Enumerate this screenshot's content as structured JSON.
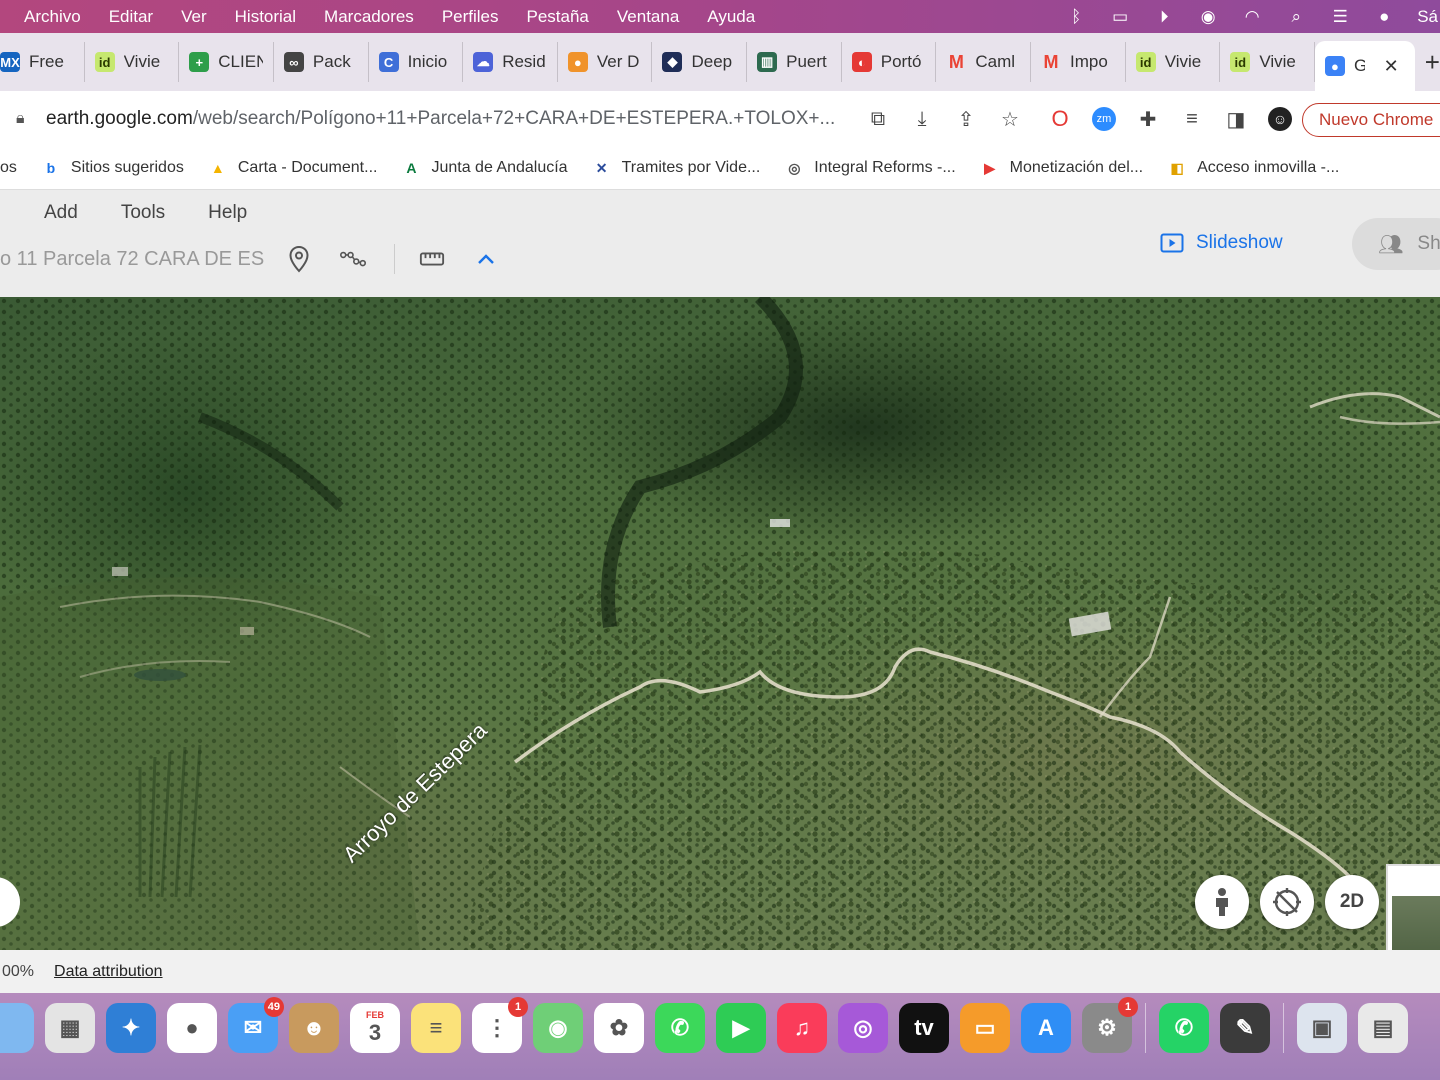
{
  "menubar": {
    "items": [
      "Archivo",
      "Editar",
      "Ver",
      "Historial",
      "Marcadores",
      "Perfiles",
      "Pestaña",
      "Ventana",
      "Ayuda"
    ],
    "right_text": "Sá"
  },
  "tabs": [
    {
      "label": "Free",
      "fav": "MX",
      "color": "#1565c0"
    },
    {
      "label": "Vivie",
      "fav": "id",
      "color": "#c6e86f"
    },
    {
      "label": "CLIEN",
      "fav": "+",
      "color": "#2e9e4a"
    },
    {
      "label": "Pack",
      "fav": "∞",
      "color": "#444444"
    },
    {
      "label": "Inicio",
      "fav": "C",
      "color": "#3f6fd8"
    },
    {
      "label": "Resid",
      "fav": "☁",
      "color": "#4d63d8"
    },
    {
      "label": "Ver D",
      "fav": "●",
      "color": "#f0932b"
    },
    {
      "label": "Deep",
      "fav": "◆",
      "color": "#1f2d57"
    },
    {
      "label": "Puert",
      "fav": "▥",
      "color": "#2d6a4f"
    },
    {
      "label": "Portó",
      "fav": "◐",
      "color": "#e53935"
    },
    {
      "label": "Caml",
      "fav": "M",
      "color": "#ea4335"
    },
    {
      "label": "Impo",
      "fav": "M",
      "color": "#ea4335"
    },
    {
      "label": "Vivie",
      "fav": "id",
      "color": "#c6e86f"
    },
    {
      "label": "Vivie",
      "fav": "id",
      "color": "#c6e86f"
    },
    {
      "label": "G",
      "fav": "●",
      "color": "#3b82f6",
      "active": true
    }
  ],
  "address": {
    "domain": "earth.google.com",
    "path": "/web/search/Polígono+11+Parcela+72+CARA+DE+ESTEPERA.+TOLOX+...",
    "nuevo_chrome": "Nuevo Chrome"
  },
  "bookmarks": [
    {
      "label": "os",
      "ico": "",
      "color": "#333"
    },
    {
      "label": "Sitios sugeridos",
      "ico": "b",
      "color": "#1a73e8"
    },
    {
      "label": "Carta - Document...",
      "ico": "▲",
      "color": "#f4b400"
    },
    {
      "label": "Junta de Andalucía",
      "ico": "A",
      "color": "#0b7a3e"
    },
    {
      "label": "Tramites por Vide...",
      "ico": "✕",
      "color": "#2b4c9b"
    },
    {
      "label": "Integral Reforms -...",
      "ico": "◎",
      "color": "#555"
    },
    {
      "label": "Monetización del...",
      "ico": "▶",
      "color": "#e53935"
    },
    {
      "label": "Acceso inmovilla -...",
      "ico": "◧",
      "color": "#e0a100"
    }
  ],
  "earth": {
    "menu": [
      "Add",
      "Tools",
      "Help"
    ],
    "search_text": "o 11 Parcela 72 CARA DE ES",
    "slideshow": "Slideshow",
    "share": "Sha",
    "river_label": "Arroyo de Estepera",
    "ctrl_2d": "2D"
  },
  "status": {
    "zoom": "00%",
    "attribution": "Data attribution"
  },
  "dock": {
    "apps": [
      {
        "name": "finder",
        "color": "#7fb8f0",
        "glyph": ""
      },
      {
        "name": "launchpad",
        "color": "#e4e4e4",
        "glyph": "▦"
      },
      {
        "name": "safari",
        "color": "#2f7fd6",
        "glyph": "✦"
      },
      {
        "name": "chrome",
        "color": "#ffffff",
        "glyph": "●"
      },
      {
        "name": "mail",
        "color": "#4a9ff5",
        "glyph": "✉",
        "badge": "49"
      },
      {
        "name": "contacts",
        "color": "#c89a5e",
        "glyph": "☻"
      },
      {
        "name": "calendar",
        "color": "#ffffff",
        "glyph": "3",
        "sub": "FEB"
      },
      {
        "name": "notes",
        "color": "#fbe27a",
        "glyph": "≡"
      },
      {
        "name": "reminders",
        "color": "#ffffff",
        "glyph": "⋮",
        "badge": "1"
      },
      {
        "name": "maps",
        "color": "#6fcf77",
        "glyph": "◉"
      },
      {
        "name": "photos",
        "color": "#ffffff",
        "glyph": "✿"
      },
      {
        "name": "messages",
        "color": "#3cd85a",
        "glyph": "✆"
      },
      {
        "name": "facetime",
        "color": "#2ecc55",
        "glyph": "▶"
      },
      {
        "name": "music",
        "color": "#fa3c5a",
        "glyph": "♫"
      },
      {
        "name": "podcasts",
        "color": "#a659d8",
        "glyph": "◎"
      },
      {
        "name": "tv",
        "color": "#111111",
        "glyph": "tv"
      },
      {
        "name": "books",
        "color": "#f59b2a",
        "glyph": "▭"
      },
      {
        "name": "app-store",
        "color": "#2f8ef5",
        "glyph": "A"
      },
      {
        "name": "system-settings",
        "color": "#8a8a8a",
        "glyph": "⚙",
        "badge": "1"
      },
      {
        "name": "whatsapp",
        "color": "#25d366",
        "glyph": "✆"
      },
      {
        "name": "preview",
        "color": "#3b3b3b",
        "glyph": "✎"
      },
      {
        "name": "screenshot",
        "color": "#dde4ee",
        "glyph": "▣"
      },
      {
        "name": "recent-window",
        "color": "#e9e9e9",
        "glyph": "▤"
      }
    ]
  }
}
